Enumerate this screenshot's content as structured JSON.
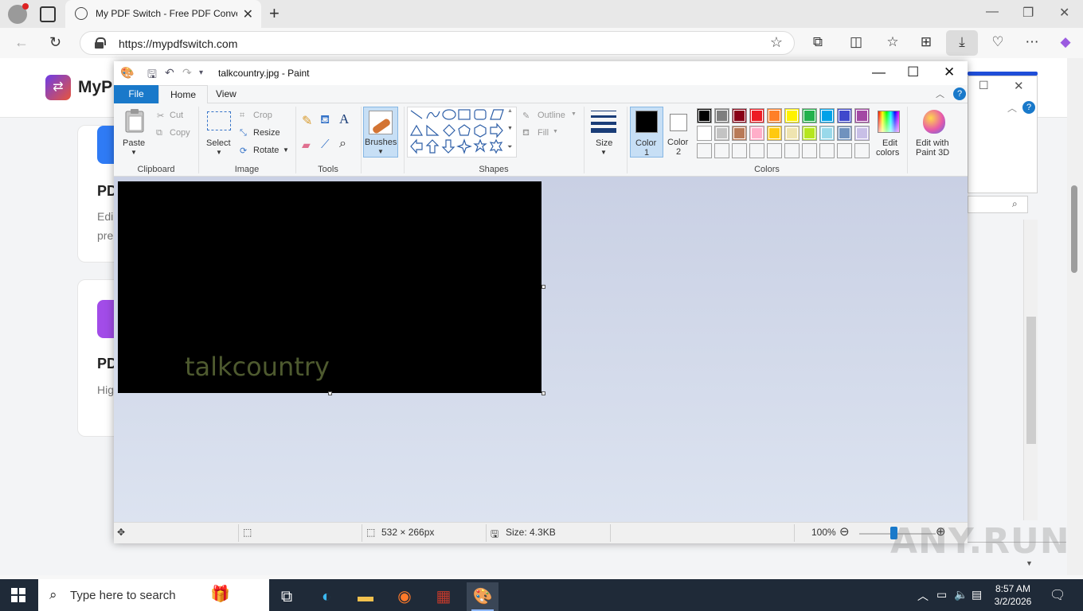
{
  "browser": {
    "tab_title": "My PDF Switch - Free PDF Conver",
    "url": "https://mypdfswitch.com"
  },
  "site": {
    "brand": "MyP",
    "cards": [
      {
        "heading": "PD",
        "line1": "Edi",
        "line2": "pre",
        "icon_color": "#2f7bf5"
      },
      {
        "heading": "PD",
        "line1": "Hig",
        "line2": "",
        "icon_color": "#a24ce8"
      }
    ]
  },
  "paint": {
    "title": "talkcountry.jpg - Paint",
    "menu": {
      "file": "File",
      "home": "Home",
      "view": "View"
    },
    "clipboard": {
      "paste": "Paste",
      "cut": "Cut",
      "copy": "Copy",
      "label": "Clipboard"
    },
    "image": {
      "select": "Select",
      "crop": "Crop",
      "resize": "Resize",
      "rotate": "Rotate",
      "label": "Image"
    },
    "tools": {
      "label": "Tools"
    },
    "brushes": {
      "label": "Brushes"
    },
    "shapes": {
      "outline": "Outline",
      "fill": "Fill",
      "label": "Shapes"
    },
    "size": {
      "label": "Size"
    },
    "color1": {
      "line1": "Color",
      "line2": "1"
    },
    "color2": {
      "line1": "Color",
      "line2": "2"
    },
    "colors_label": "Colors",
    "edit_colors": {
      "line1": "Edit",
      "line2": "colors"
    },
    "edit_3d": {
      "line1": "Edit with",
      "line2": "Paint 3D"
    },
    "palette_row1": [
      "#000000",
      "#7f7f7f",
      "#880015",
      "#ed1c24",
      "#ff7f27",
      "#fff200",
      "#22b14c",
      "#00a2e8",
      "#3f48cc",
      "#a349a4"
    ],
    "palette_row2": [
      "#ffffff",
      "#c3c3c3",
      "#b97a57",
      "#ffaec9",
      "#ffc90e",
      "#efe4b0",
      "#b5e61d",
      "#99d9ea",
      "#7092be",
      "#c8bfe7"
    ],
    "image_text": "talkcountry",
    "image_text_color": "#4e5a2f",
    "status": {
      "dimensions": "532 × 266px",
      "size": "Size: 4.3KB",
      "zoom": "100%"
    }
  },
  "watermark": "ANY.RUN",
  "taskbar": {
    "search_placeholder": "Type here to search",
    "time": "8:57 AM",
    "date": "3/2/2026"
  }
}
